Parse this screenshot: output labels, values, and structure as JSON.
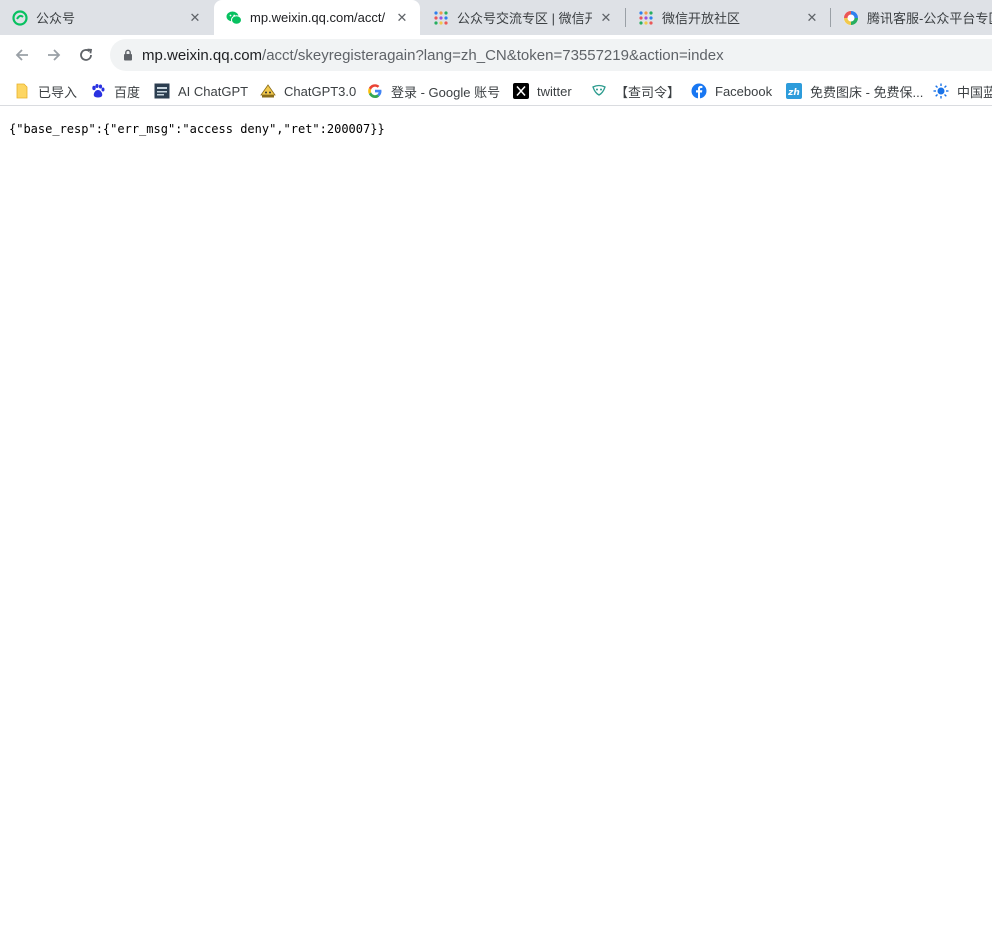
{
  "tabs": [
    {
      "title": "公众号",
      "icon": "wechat-mp-icon",
      "active": false
    },
    {
      "title": "mp.weixin.qq.com/acct/",
      "icon": "wechat-icon",
      "active": true
    },
    {
      "title": "公众号交流专区 | 微信开放",
      "icon": "wechat-dev-community-icon",
      "active": false
    },
    {
      "title": "微信开放社区",
      "icon": "wechat-dev-community-icon",
      "active": false
    },
    {
      "title": "腾讯客服-公众平台专区",
      "icon": "tencent-support-icon",
      "active": false
    }
  ],
  "close_glyph": "✕",
  "address_bar": {
    "host": "mp.weixin.qq.com",
    "path": "/acct/skeyregisteragain?lang=zh_CN&token=73557219&action=index"
  },
  "bookmarks": [
    {
      "label": "已导入",
      "icon": "folder-icon"
    },
    {
      "label": "百度",
      "icon": "baidu-icon"
    },
    {
      "label": "AI ChatGPT",
      "icon": "ai-chatgpt-icon"
    },
    {
      "label": "ChatGPT3.0",
      "icon": "chatgpt-icon"
    },
    {
      "label": "登录 - Google 账号",
      "icon": "google-icon"
    },
    {
      "label": "twitter",
      "icon": "x-twitter-icon"
    },
    {
      "label": "【查司令】",
      "icon": "chasiling-icon"
    },
    {
      "label": "Facebook",
      "icon": "facebook-icon"
    },
    {
      "label": "免费图床 - 免费保...",
      "icon": "zh-icon"
    },
    {
      "label": "中国蓝",
      "icon": "blue-sun-icon"
    }
  ],
  "page": {
    "body_text": "{\"base_resp\":{\"err_msg\":\"access deny\",\"ret\":200007}}"
  },
  "colors": {
    "tabstrip_bg": "#dee1e6",
    "omnibox_bg": "#f1f3f4",
    "wechat_green": "#07c160",
    "facebook_blue": "#1877f2"
  }
}
